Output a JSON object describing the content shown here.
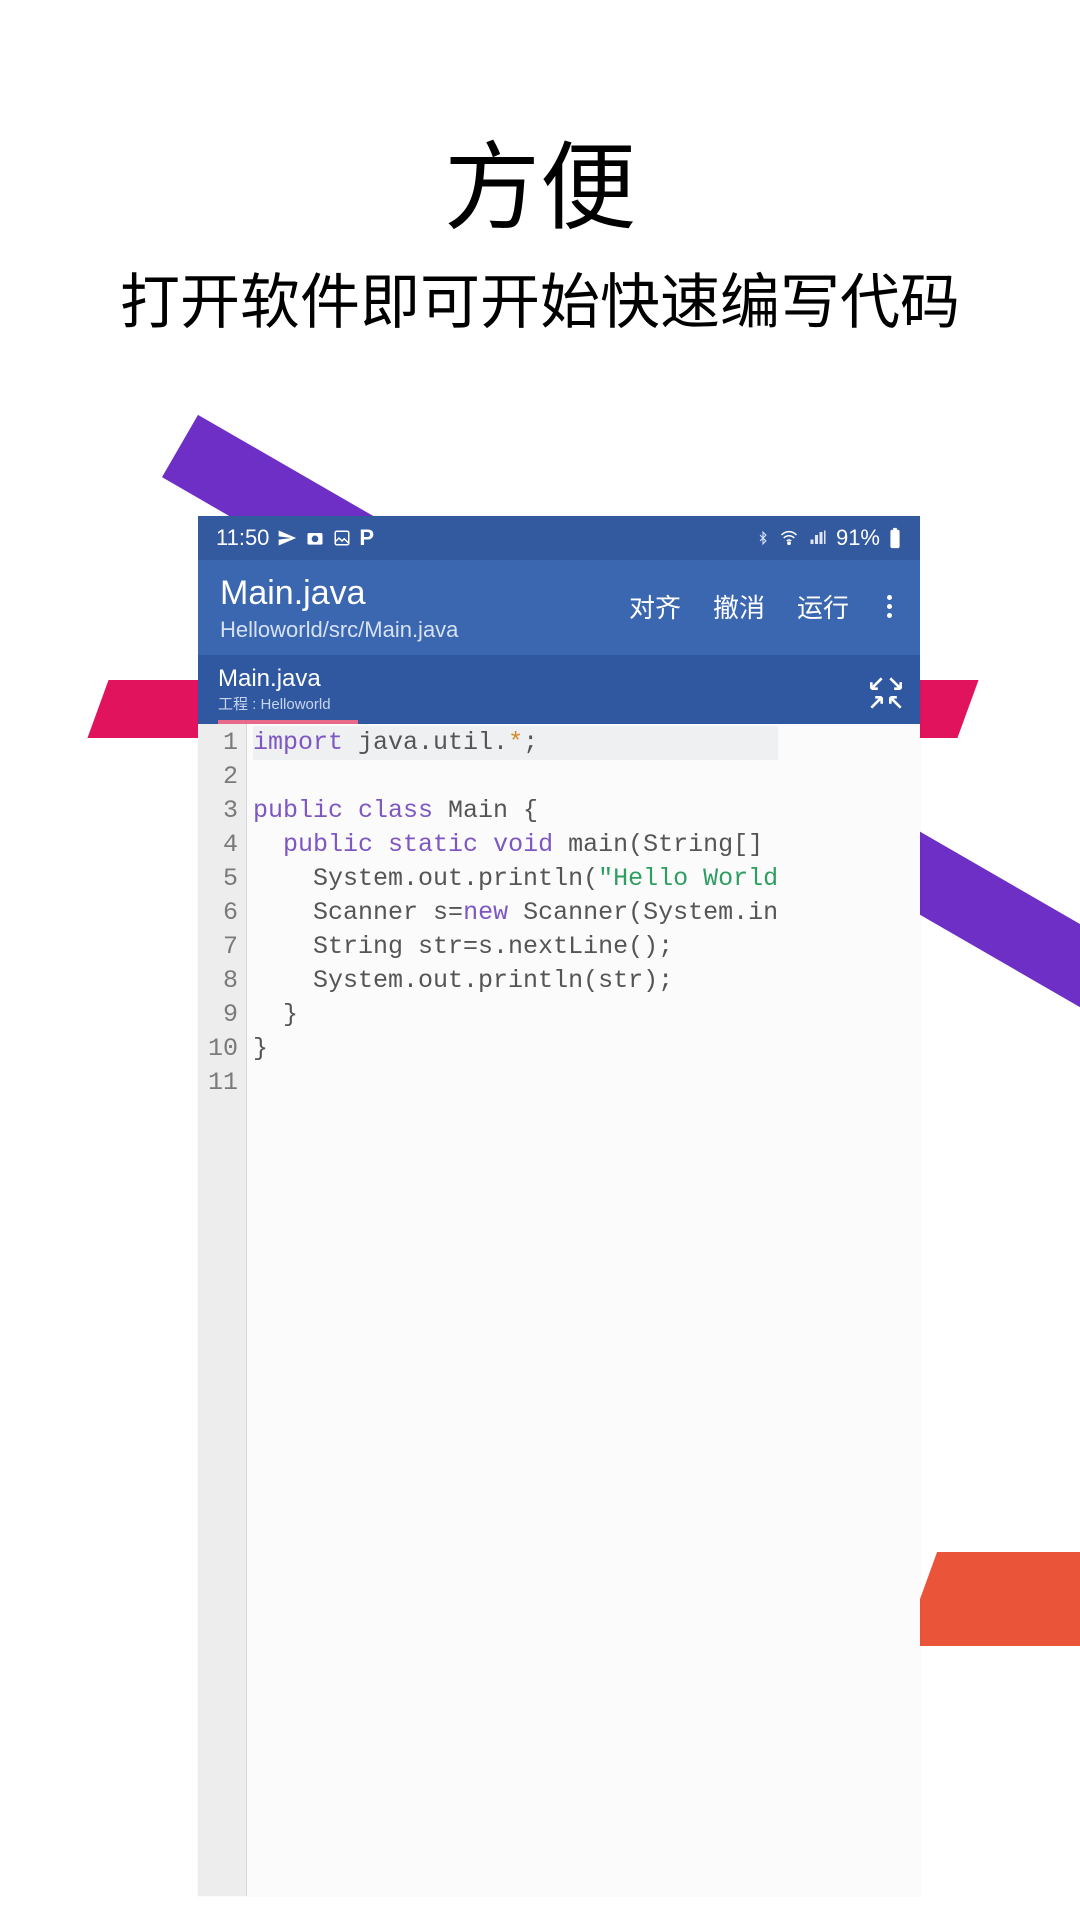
{
  "promo": {
    "title": "方便",
    "subtitle": "打开软件即可开始快速编写代码"
  },
  "status_bar": {
    "time": "11:50",
    "left_icons": [
      "send-icon",
      "camera-icon",
      "picture-icon",
      "p-icon"
    ],
    "right_icons": [
      "bluetooth-icon",
      "wifi-icon",
      "signal-icon"
    ],
    "battery_percent": "91%",
    "battery_icon": "battery-icon"
  },
  "app_bar": {
    "title": "Main.java",
    "path": "Helloworld/src/Main.java",
    "actions": {
      "align": "对齐",
      "undo": "撤消",
      "run": "运行"
    }
  },
  "tab": {
    "name": "Main.java",
    "project_label": "工程",
    "project_name": "Helloworld"
  },
  "editor": {
    "line_numbers": [
      "1",
      "2",
      "3",
      "4",
      "5",
      "6",
      "7",
      "8",
      "9",
      "10",
      "11"
    ],
    "code_lines": [
      {
        "tokens": [
          {
            "t": "import",
            "c": "kw"
          },
          {
            "t": " java.util.",
            "c": "txt"
          },
          {
            "t": "*",
            "c": "op"
          },
          {
            "t": ";",
            "c": "txt"
          }
        ],
        "hl": true
      },
      {
        "tokens": []
      },
      {
        "tokens": [
          {
            "t": "public class",
            "c": "kw"
          },
          {
            "t": " Main {",
            "c": "txt"
          }
        ]
      },
      {
        "tokens": [
          {
            "t": "  ",
            "c": "txt"
          },
          {
            "t": "public static void",
            "c": "kw"
          },
          {
            "t": " main(String[]",
            "c": "txt"
          }
        ]
      },
      {
        "tokens": [
          {
            "t": "    System.out.println(",
            "c": "txt"
          },
          {
            "t": "\"Hello World",
            "c": "str"
          }
        ]
      },
      {
        "tokens": [
          {
            "t": "    Scanner s=",
            "c": "txt"
          },
          {
            "t": "new",
            "c": "kw"
          },
          {
            "t": " Scanner(System.in",
            "c": "txt"
          }
        ]
      },
      {
        "tokens": [
          {
            "t": "    String str=s.nextLine();",
            "c": "txt"
          }
        ]
      },
      {
        "tokens": [
          {
            "t": "    System.out.println(str);",
            "c": "txt"
          }
        ]
      },
      {
        "tokens": [
          {
            "t": "  }",
            "c": "txt"
          }
        ]
      },
      {
        "tokens": [
          {
            "t": "}",
            "c": "txt"
          }
        ]
      },
      {
        "tokens": []
      }
    ]
  }
}
